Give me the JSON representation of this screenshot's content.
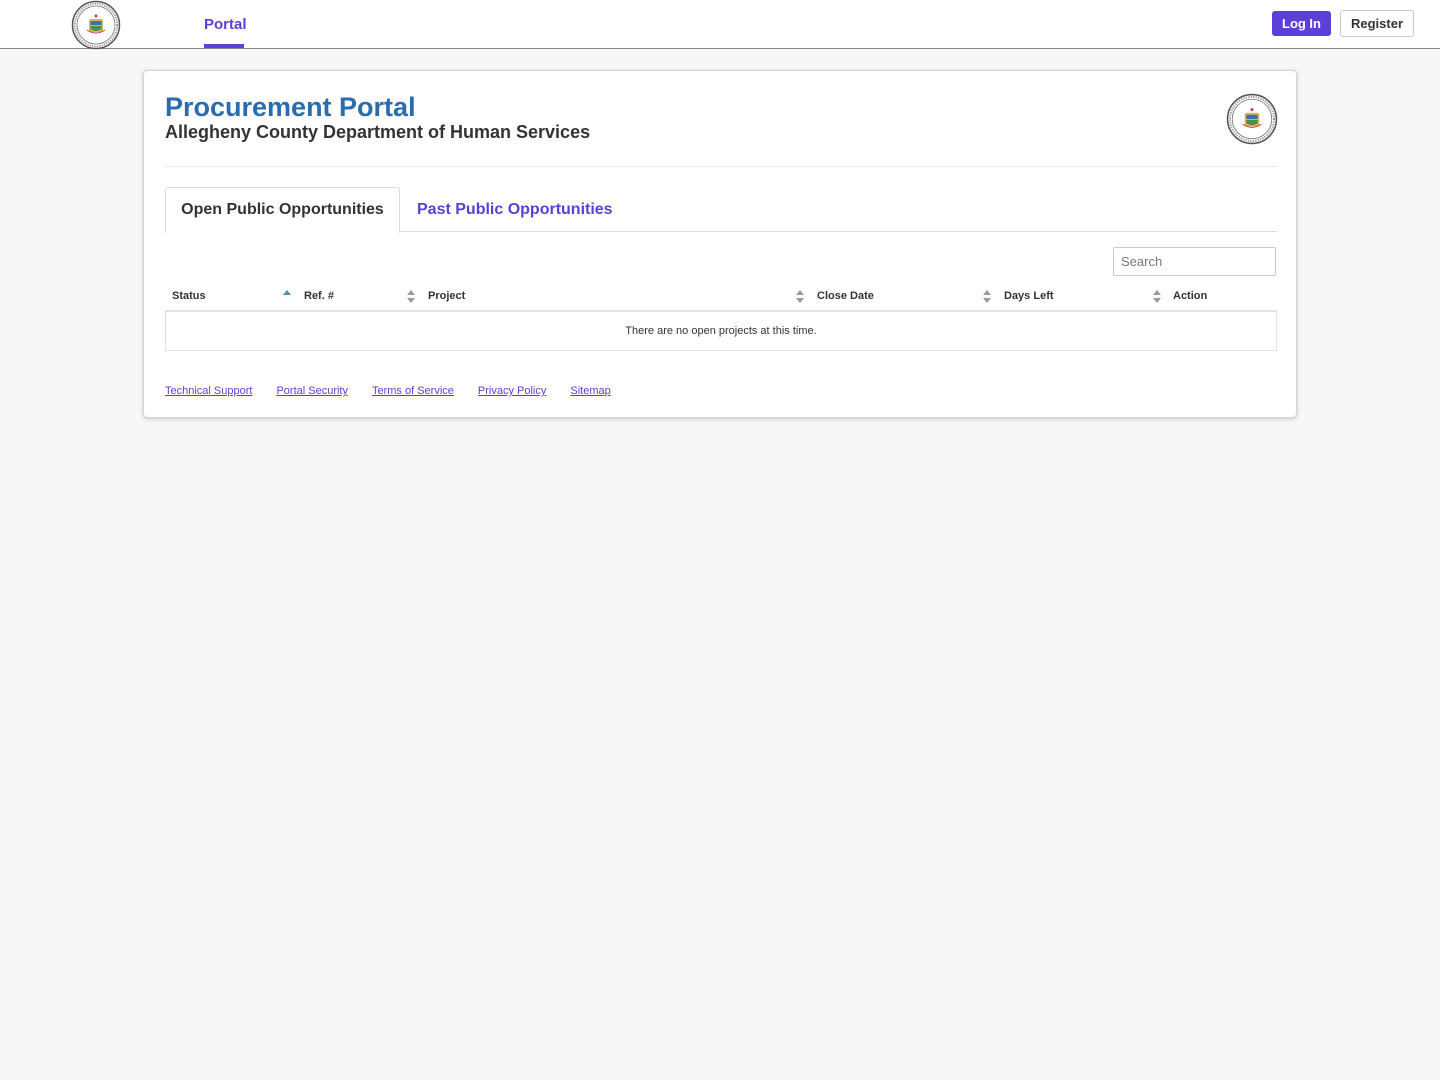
{
  "nav": {
    "logo_icon": "county-seal-icon",
    "tab_label": "Portal",
    "login_label": "Log In",
    "register_label": "Register",
    "accent_color": "#5b3fd6"
  },
  "header": {
    "title": "Procurement Portal",
    "subtitle": "Allegheny County Department of Human Services",
    "title_color": "#2b6cb0",
    "logo_icon": "county-seal-icon"
  },
  "tabs": [
    {
      "label": "Open Public Opportunities",
      "active": true
    },
    {
      "label": "Past Public Opportunities",
      "active": false
    }
  ],
  "search": {
    "placeholder": "Search",
    "value": ""
  },
  "table": {
    "columns": [
      "Status",
      "Ref. #",
      "Project",
      "Close Date",
      "Days Left",
      "Action"
    ],
    "sorted_column": "Status",
    "sort_direction": "ascending",
    "empty_message": "There are no open projects at this time."
  },
  "footer": {
    "links": [
      "Technical Support",
      "Portal Security",
      "Terms of Service",
      "Privacy Policy",
      "Sitemap"
    ]
  }
}
